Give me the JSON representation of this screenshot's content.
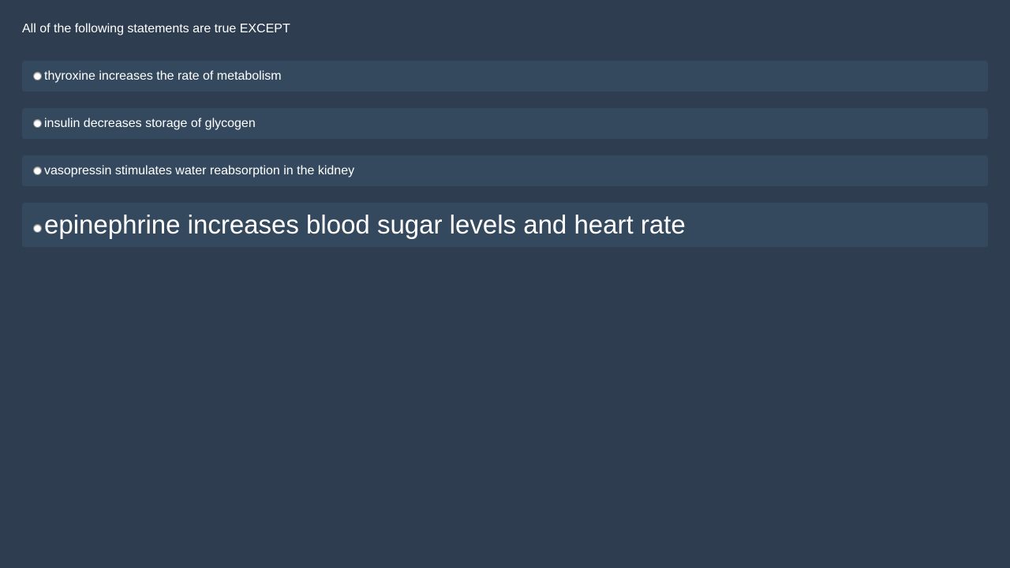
{
  "question": {
    "text": "All of the following statements are true EXCEPT"
  },
  "options": [
    {
      "label": "thyroxine increases the rate of metabolism",
      "selected": false
    },
    {
      "label": "insulin decreases storage of glycogen",
      "selected": false
    },
    {
      "label": "vasopressin stimulates water reabsorption in the kidney",
      "selected": false
    },
    {
      "label": "epinephrine increases blood sugar levels and heart rate",
      "selected": false
    }
  ],
  "colors": {
    "background": "#2e3d4f",
    "option_background": "#34495e",
    "text": "#ffffff"
  }
}
